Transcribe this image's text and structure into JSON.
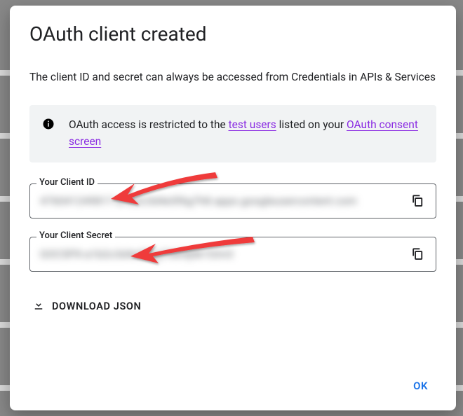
{
  "dialog": {
    "title": "OAuth client created",
    "subtitle": "The client ID and secret can always be accessed from Credentials in APIs & Services"
  },
  "notice": {
    "prefix": "OAuth access is restricted to the ",
    "link1": "test users",
    "mid": " listed on your ",
    "link2": "OAuth consent screen"
  },
  "fields": {
    "client_id": {
      "label": "Your Client ID",
      "value": "476041249817-a1b2c3d4e5f6g7h8.apps.googleusercontent.com"
    },
    "client_secret": {
      "label": "Your Client Secret",
      "value": "GOCSPX-a1b2c3d4e5f6g7h8i9j0k1l2m3"
    }
  },
  "buttons": {
    "download": "DOWNLOAD JSON",
    "ok": "OK"
  }
}
